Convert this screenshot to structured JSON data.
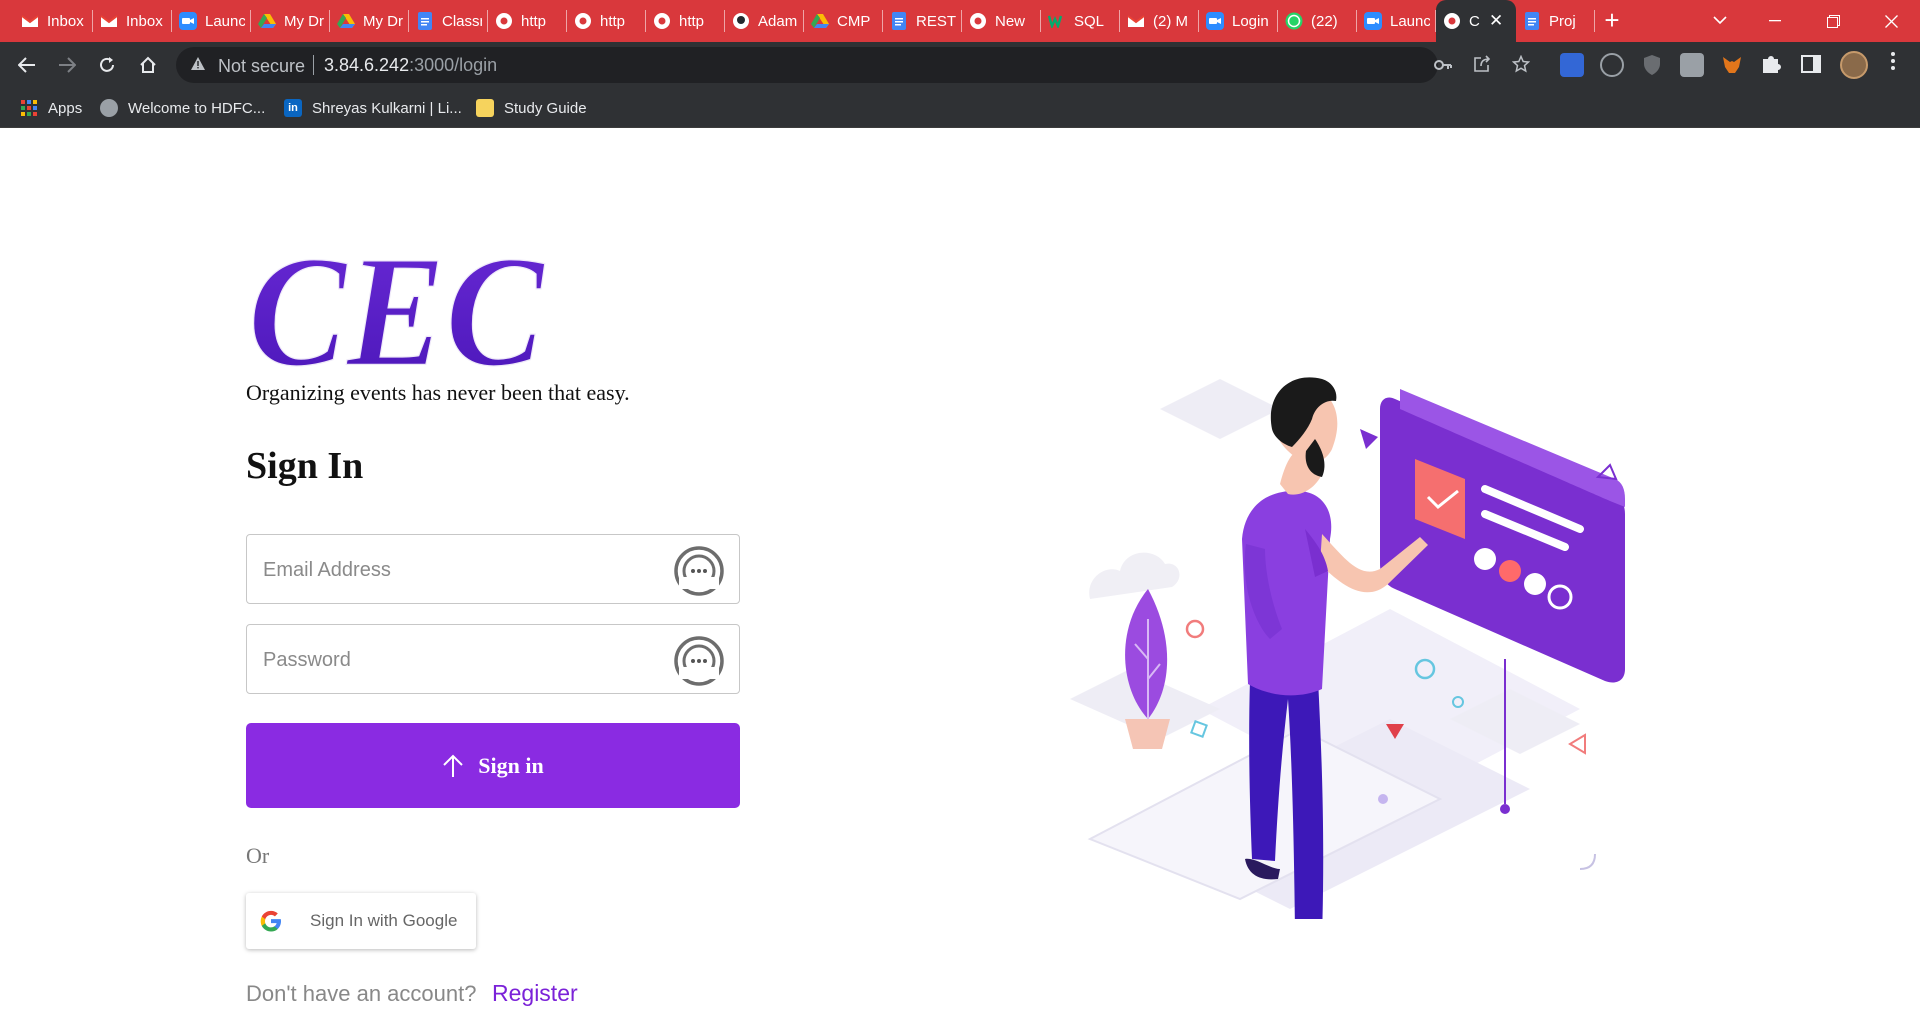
{
  "browser": {
    "tabs": [
      {
        "title": "Inbox",
        "icon": "gmail-icon",
        "color": "#ffffff"
      },
      {
        "title": "Inbox",
        "icon": "gmail-icon",
        "color": "#ffffff"
      },
      {
        "title": "Launch",
        "icon": "zoom-icon",
        "color": "#2d8cff"
      },
      {
        "title": "My Drive",
        "icon": "drive-icon",
        "color": "#ffffff"
      },
      {
        "title": "My Drive",
        "icon": "drive-icon",
        "color": "#ffffff"
      },
      {
        "title": "Classroom",
        "icon": "docs-icon",
        "color": "#4285f4"
      },
      {
        "title": "http",
        "icon": "globe-icon",
        "color": "#ffffff"
      },
      {
        "title": "http",
        "icon": "globe-icon",
        "color": "#ffffff"
      },
      {
        "title": "http",
        "icon": "globe-icon",
        "color": "#ffffff"
      },
      {
        "title": "Adam",
        "icon": "github-icon",
        "color": "#ffffff"
      },
      {
        "title": "CMP",
        "icon": "drive-icon",
        "color": "#ffffff"
      },
      {
        "title": "REST",
        "icon": "docs-icon",
        "color": "#4285f4"
      },
      {
        "title": "New",
        "icon": "chrome-icon",
        "color": "#ffffff"
      },
      {
        "title": "SQL",
        "icon": "w3-icon",
        "color": "#04aa6d"
      },
      {
        "title": "(2) M",
        "icon": "gmail-icon",
        "color": "#ffffff"
      },
      {
        "title": "Login",
        "icon": "zoom-icon",
        "color": "#2d8cff"
      },
      {
        "title": "(22)",
        "icon": "whatsapp-icon",
        "color": "#25d366"
      },
      {
        "title": "Launch",
        "icon": "zoom-icon",
        "color": "#2d8cff"
      },
      {
        "title": "C",
        "icon": "globe-icon",
        "color": "#ffffff",
        "active": true
      },
      {
        "title": "Proj",
        "icon": "docs-icon",
        "color": "#4285f4"
      }
    ],
    "address": {
      "not_secure": "Not secure",
      "host": "3.84.6.242",
      "path": ":3000/login"
    },
    "bookmarks": [
      {
        "label": "Apps"
      },
      {
        "label": "Welcome to HDFC..."
      },
      {
        "label": "Shreyas Kulkarni | Li..."
      },
      {
        "label": "Study Guide"
      }
    ]
  },
  "page": {
    "logo_text": "CEC",
    "tagline": "Organizing events has never been that easy.",
    "heading": "Sign In",
    "email_placeholder": "Email Address",
    "password_placeholder": "Password",
    "signin_label": "Sign in",
    "or_label": "Or",
    "google_label": "Sign In with Google",
    "no_account": "Don't have an account?",
    "register_label": "Register"
  },
  "colors": {
    "accent": "#8a2be2",
    "logo": "#5b1fc9",
    "tabstrip": "#d9383c",
    "toolbar": "#2f3134"
  }
}
